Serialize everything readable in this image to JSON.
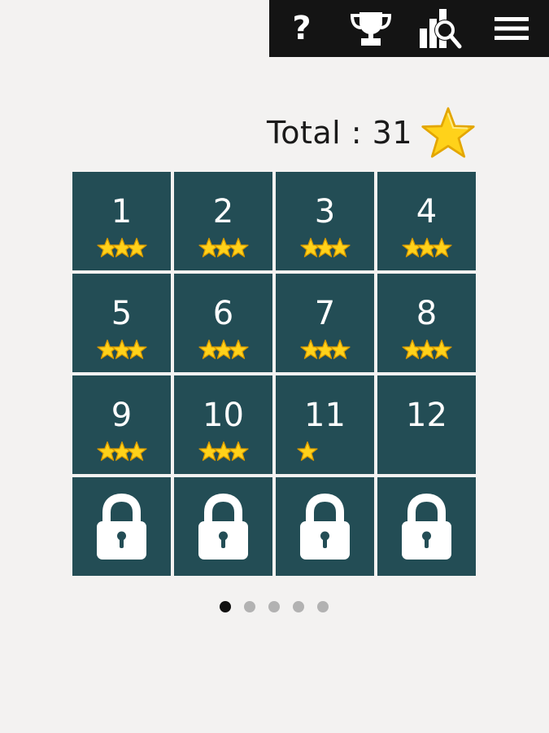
{
  "toolbar": {
    "help_glyph": "?",
    "icons": [
      "help-icon",
      "trophy-icon",
      "stats-search-icon",
      "menu-icon"
    ],
    "color": "#141414"
  },
  "total": {
    "label": "Total : 31",
    "icon": "star-icon"
  },
  "colors": {
    "background": "#f3f2f1",
    "tile": "#234d55",
    "star": "#ffd21a"
  },
  "levels": [
    {
      "number": "1",
      "stars": 3
    },
    {
      "number": "2",
      "stars": 3
    },
    {
      "number": "3",
      "stars": 3
    },
    {
      "number": "4",
      "stars": 3
    },
    {
      "number": "5",
      "stars": 3
    },
    {
      "number": "6",
      "stars": 3
    },
    {
      "number": "7",
      "stars": 3
    },
    {
      "number": "8",
      "stars": 3
    },
    {
      "number": "9",
      "stars": 3
    },
    {
      "number": "10",
      "stars": 3
    },
    {
      "number": "11",
      "stars": 1
    },
    {
      "number": "12",
      "stars": 0
    }
  ],
  "locked_count": 4,
  "pagination": {
    "pages": 5,
    "current": 1
  }
}
